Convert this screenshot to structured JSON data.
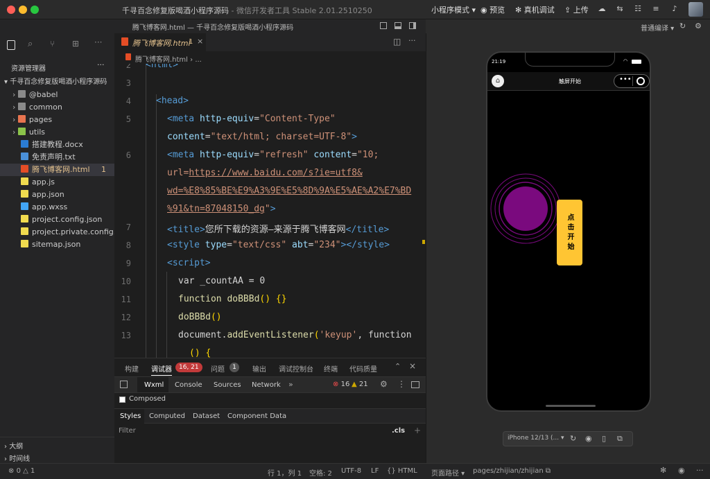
{
  "window": {
    "title": "千寻百念修复版喝酒小程序源码",
    "title_suffix": " - 微信开发者工具 Stable 2.01.2510250",
    "editor_title": "腾飞博客网.html — 千寻百念修复版喝酒小程序源码"
  },
  "toolbar": {
    "mode": "小程序模式",
    "preview": "预览",
    "real_debug": "真机调试",
    "upload": "上传",
    "compile_mode": "普通编译"
  },
  "explorer": {
    "header": "资源管理器",
    "project": "千寻百念修复版喝酒小程序源码",
    "items": [
      {
        "label": "@babel",
        "icon": "folder-icon",
        "color": "#8a8a8a"
      },
      {
        "label": "common",
        "icon": "folder-icon",
        "color": "#8a8a8a"
      },
      {
        "label": "pages",
        "icon": "folder-icon",
        "color": "#e8744f"
      },
      {
        "label": "utils",
        "icon": "folder-icon",
        "color": "#8bc34a"
      },
      {
        "label": "搭建教程.docx",
        "icon": "word-icon",
        "color": "#2b7cd3"
      },
      {
        "label": "免责声明.txt",
        "icon": "text-file-icon",
        "color": "#4a90d9"
      },
      {
        "label": "腾飞博客网.html",
        "icon": "html-icon",
        "color": "#e44d26",
        "badge": "1"
      },
      {
        "label": "app.js",
        "icon": "js-icon",
        "color": "#f0db4f"
      },
      {
        "label": "app.json",
        "icon": "json-icon",
        "color": "#f0db4f"
      },
      {
        "label": "app.wxss",
        "icon": "css-icon",
        "color": "#42a5f5"
      },
      {
        "label": "project.config.json",
        "icon": "json-icon",
        "color": "#f0db4f"
      },
      {
        "label": "project.private.config...",
        "icon": "json-icon",
        "color": "#f0db4f"
      },
      {
        "label": "sitemap.json",
        "icon": "json-icon",
        "color": "#f0db4f"
      }
    ],
    "outline": "大纲",
    "timeline": "时间线"
  },
  "editor": {
    "tab_label": "腾飞博客网.html",
    "tab_badge": "1",
    "breadcrumb_file": "腾飞博客网.html",
    "breadcrumb_more": "...",
    "line_numbers": [
      "2",
      "3",
      "4",
      "5",
      "6",
      "7",
      "8",
      "9",
      "10",
      "11",
      "12",
      "13"
    ]
  },
  "panel": {
    "tabs": [
      "构建",
      "调试器",
      "问题",
      "输出",
      "调试控制台",
      "终端",
      "代码质量"
    ],
    "debugger_badge": "16, 21",
    "problems_badge": "1",
    "devtools_tabs": [
      "Wxml",
      "Console",
      "Sources",
      "Network"
    ],
    "errors": "16",
    "warnings": "21",
    "composed": "Composed",
    "styles_tabs": [
      "Styles",
      "Computed",
      "Dataset",
      "Component Data"
    ],
    "filter_placeholder": "Filter",
    "cls": ".cls"
  },
  "statusbar": {
    "errors": "0",
    "warnings": "1",
    "position": "行 1，列 1",
    "spaces": "空格: 2",
    "encoding": "UTF-8",
    "eol": "LF",
    "language": "HTML",
    "page_path_label": "页面路径",
    "page_path": "pages/zhijian/zhijian"
  },
  "simulator": {
    "time": "21:19",
    "nav_title": "触屏开始",
    "start_button": "点击开始",
    "device": "iPhone 12/13 (..."
  },
  "colors": {
    "accent": "#ffc533",
    "circle": "#7a0a7e",
    "error": "#f14c4c",
    "warning": "#cca700"
  }
}
